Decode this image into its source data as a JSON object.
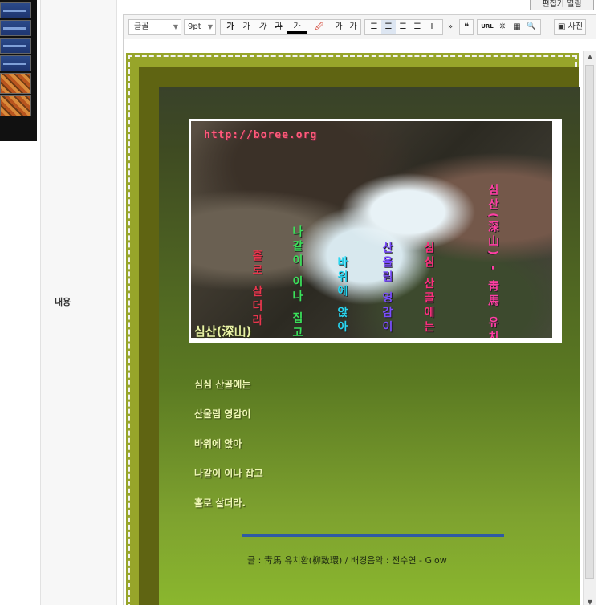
{
  "top_button_label": "편집기 열림",
  "form_label": "내용",
  "toolbar": {
    "font_select": "글꼴",
    "size_select": "9pt",
    "bold": "가",
    "underline": "가",
    "italic": "가",
    "strike": "가",
    "font_color": "가",
    "bg_color": "🖉",
    "superscript": "가",
    "subscript": "가",
    "more": "»",
    "quote": "❝",
    "url": "URL",
    "special_char": "❊",
    "table": "▦",
    "find": "🔍",
    "photo_label": "사진"
  },
  "image": {
    "watermark": "http://boree.org",
    "vertical_lines": [
      {
        "text": "홀로 살더라",
        "color": "#e8364c"
      },
      {
        "text": "나같이 이나 집고",
        "color": "#3be15a"
      },
      {
        "text": "바위에 앉아",
        "color": "#28d7f2"
      },
      {
        "text": "산울림 영감이",
        "color": "#7a4dff"
      },
      {
        "text": "심심 산골에는",
        "color": "#ff2f7d"
      },
      {
        "text": "심산(深山) - 靑馬 유치환",
        "color": "#ff3fa4"
      }
    ]
  },
  "poem": {
    "title": "심산(深山)",
    "lines": [
      "심심 산골에는",
      "산울림 영감이",
      "바위에 앉아",
      "나같이 이나 잡고",
      "홀로 살더라."
    ],
    "credit": "글 : 靑馬 유치환(柳致環) / 배경음악 : 전수연 - Glow"
  },
  "colors": {
    "frame": "#97a52a",
    "panel_top": "#39422a",
    "panel_bottom": "#8dbb2e",
    "rule": "#2f5aa4"
  }
}
